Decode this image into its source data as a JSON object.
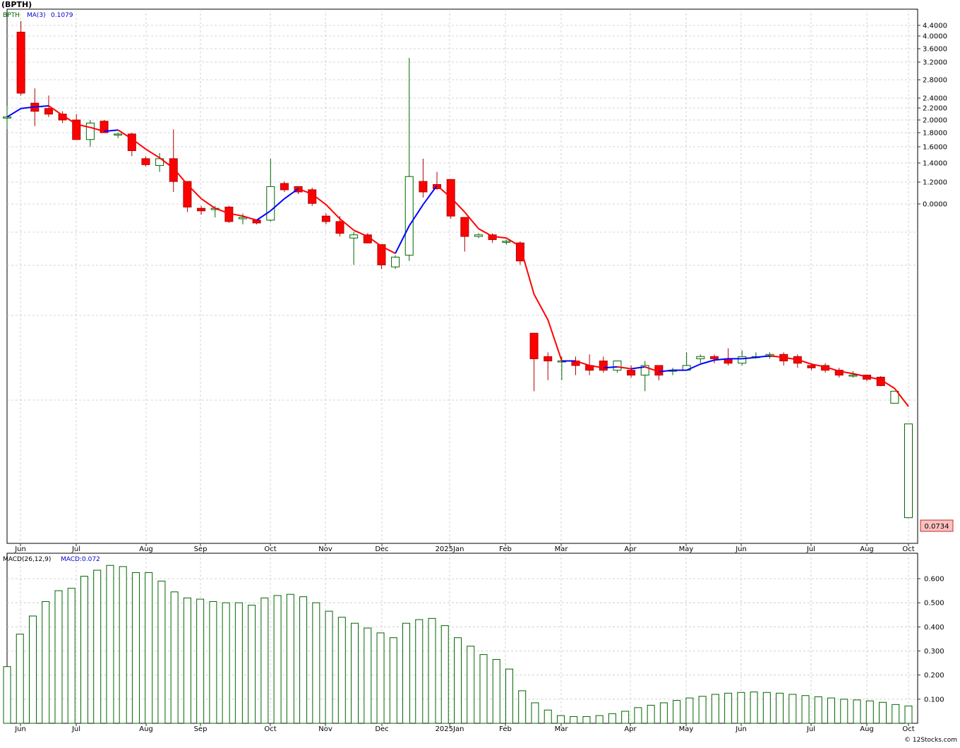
{
  "title": "(BPTH)",
  "watermark": "© 12Stocks.com",
  "price_panel": {
    "legend_symbol": "BPTH",
    "legend_ma_label": "MA(3)",
    "legend_ma_value": "0.1079",
    "last_price_label": "0.0734"
  },
  "macd_panel": {
    "legend_label": "MACD(26,12,9)",
    "legend_value": "MACD:0.072"
  },
  "colors": {
    "down_candle": "#ff0000",
    "up_candle": "#ffffff",
    "candle_outline_up": "#006600",
    "candle_outline_down": "#b00000",
    "ma_rising": "#0000ff",
    "ma_falling": "#ff0000",
    "macd_bar": "#006600",
    "grid": "#c8c8c8",
    "last_price_bg": "#ffc0c0"
  },
  "chart_data": [
    {
      "type": "candlestick",
      "title": "(BPTH)",
      "y_axis_tick_labels": [
        "4.4000",
        "4.0000",
        "3.6000",
        "3.2000",
        "2.8000",
        "2.4000",
        "2.2000",
        "2.0000",
        "1.8000",
        "1.6000",
        "1.4000",
        "1.2000",
        "0.0000"
      ],
      "x_axis_tick_labels": [
        "Jun",
        "Jul",
        "Aug",
        "Sep",
        "Oct",
        "Nov",
        "Dec",
        "2025Jan",
        "Feb",
        "Mar",
        "Apr",
        "May",
        "Jun",
        "Jul",
        "Aug",
        "Oct"
      ],
      "y_scale": "log",
      "grid": true,
      "candles": [
        {
          "o": 2.05,
          "h": 2.25,
          "l": 1.85,
          "c": 2.05
        },
        {
          "o": 4.15,
          "h": 4.55,
          "l": 2.45,
          "c": 2.5
        },
        {
          "o": 2.3,
          "h": 2.6,
          "l": 1.9,
          "c": 2.15
        },
        {
          "o": 2.2,
          "h": 2.45,
          "l": 2.05,
          "c": 2.1
        },
        {
          "o": 2.1,
          "h": 2.15,
          "l": 1.95,
          "c": 2.0
        },
        {
          "o": 2.0,
          "h": 2.1,
          "l": 1.7,
          "c": 1.7
        },
        {
          "o": 1.7,
          "h": 2.0,
          "l": 1.6,
          "c": 1.95
        },
        {
          "o": 1.98,
          "h": 2.0,
          "l": 1.8,
          "c": 1.8
        },
        {
          "o": 1.78,
          "h": 1.8,
          "l": 1.72,
          "c": 1.78
        },
        {
          "o": 1.78,
          "h": 1.8,
          "l": 1.48,
          "c": 1.55
        },
        {
          "o": 1.45,
          "h": 1.48,
          "l": 1.36,
          "c": 1.38
        },
        {
          "o": 1.37,
          "h": 1.52,
          "l": 1.3,
          "c": 1.45
        },
        {
          "o": 1.45,
          "h": 1.85,
          "l": 1.1,
          "c": 1.2
        },
        {
          "o": 1.2,
          "h": 1.2,
          "l": 0.93,
          "c": 0.97
        },
        {
          "o": 0.96,
          "h": 0.98,
          "l": 0.91,
          "c": 0.94
        },
        {
          "o": 0.95,
          "h": 0.98,
          "l": 0.89,
          "c": 0.96
        },
        {
          "o": 0.97,
          "h": 0.98,
          "l": 0.85,
          "c": 0.86
        },
        {
          "o": 0.88,
          "h": 0.92,
          "l": 0.84,
          "c": 0.89
        },
        {
          "o": 0.87,
          "h": 0.87,
          "l": 0.84,
          "c": 0.85
        },
        {
          "o": 0.87,
          "h": 1.45,
          "l": 0.86,
          "c": 1.15
        },
        {
          "o": 1.18,
          "h": 1.2,
          "l": 1.1,
          "c": 1.12
        },
        {
          "o": 1.15,
          "h": 1.15,
          "l": 1.08,
          "c": 1.1
        },
        {
          "o": 1.12,
          "h": 1.14,
          "l": 0.98,
          "c": 1.0
        },
        {
          "o": 0.9,
          "h": 0.92,
          "l": 0.84,
          "c": 0.86
        },
        {
          "o": 0.86,
          "h": 0.9,
          "l": 0.76,
          "c": 0.78
        },
        {
          "o": 0.75,
          "h": 0.79,
          "l": 0.6,
          "c": 0.77
        },
        {
          "o": 0.77,
          "h": 0.78,
          "l": 0.72,
          "c": 0.72
        },
        {
          "o": 0.71,
          "h": 0.71,
          "l": 0.58,
          "c": 0.6
        },
        {
          "o": 0.59,
          "h": 0.65,
          "l": 0.58,
          "c": 0.64
        },
        {
          "o": 0.65,
          "h": 3.35,
          "l": 0.62,
          "c": 1.25
        },
        {
          "o": 1.2,
          "h": 1.45,
          "l": 1.05,
          "c": 1.1
        },
        {
          "o": 1.17,
          "h": 1.3,
          "l": 1.12,
          "c": 1.13
        },
        {
          "o": 1.22,
          "h": 1.22,
          "l": 0.88,
          "c": 0.9
        },
        {
          "o": 0.89,
          "h": 0.89,
          "l": 0.67,
          "c": 0.76
        },
        {
          "o": 0.76,
          "h": 0.78,
          "l": 0.75,
          "c": 0.77
        },
        {
          "o": 0.77,
          "h": 0.78,
          "l": 0.72,
          "c": 0.74
        },
        {
          "o": 0.73,
          "h": 0.74,
          "l": 0.71,
          "c": 0.73
        },
        {
          "o": 0.72,
          "h": 0.73,
          "l": 0.6,
          "c": 0.62
        },
        {
          "o": 0.34,
          "h": 0.34,
          "l": 0.21,
          "c": 0.275
        },
        {
          "o": 0.28,
          "h": 0.29,
          "l": 0.23,
          "c": 0.27
        },
        {
          "o": 0.27,
          "h": 0.28,
          "l": 0.23,
          "c": 0.27
        },
        {
          "o": 0.27,
          "h": 0.28,
          "l": 0.24,
          "c": 0.26
        },
        {
          "o": 0.26,
          "h": 0.285,
          "l": 0.24,
          "c": 0.25
        },
        {
          "o": 0.27,
          "h": 0.28,
          "l": 0.245,
          "c": 0.25
        },
        {
          "o": 0.25,
          "h": 0.27,
          "l": 0.245,
          "c": 0.27
        },
        {
          "o": 0.25,
          "h": 0.26,
          "l": 0.235,
          "c": 0.24
        },
        {
          "o": 0.24,
          "h": 0.27,
          "l": 0.21,
          "c": 0.26
        },
        {
          "o": 0.26,
          "h": 0.26,
          "l": 0.23,
          "c": 0.24
        },
        {
          "o": 0.25,
          "h": 0.255,
          "l": 0.24,
          "c": 0.25
        },
        {
          "o": 0.25,
          "h": 0.29,
          "l": 0.25,
          "c": 0.26
        },
        {
          "o": 0.275,
          "h": 0.285,
          "l": 0.265,
          "c": 0.28
        },
        {
          "o": 0.28,
          "h": 0.285,
          "l": 0.265,
          "c": 0.275
        },
        {
          "o": 0.275,
          "h": 0.3,
          "l": 0.26,
          "c": 0.265
        },
        {
          "o": 0.265,
          "h": 0.295,
          "l": 0.26,
          "c": 0.28
        },
        {
          "o": 0.28,
          "h": 0.29,
          "l": 0.275,
          "c": 0.28
        },
        {
          "o": 0.28,
          "h": 0.29,
          "l": 0.275,
          "c": 0.285
        },
        {
          "o": 0.285,
          "h": 0.29,
          "l": 0.26,
          "c": 0.27
        },
        {
          "o": 0.28,
          "h": 0.285,
          "l": 0.255,
          "c": 0.265
        },
        {
          "o": 0.26,
          "h": 0.265,
          "l": 0.25,
          "c": 0.255
        },
        {
          "o": 0.26,
          "h": 0.265,
          "l": 0.245,
          "c": 0.25
        },
        {
          "o": 0.25,
          "h": 0.255,
          "l": 0.235,
          "c": 0.24
        },
        {
          "o": 0.24,
          "h": 0.248,
          "l": 0.235,
          "c": 0.24
        },
        {
          "o": 0.24,
          "h": 0.24,
          "l": 0.228,
          "c": 0.232
        },
        {
          "o": 0.236,
          "h": 0.238,
          "l": 0.219,
          "c": 0.22
        },
        {
          "o": 0.19,
          "h": 0.21,
          "l": 0.19,
          "c": 0.21
        },
        {
          "o": 0.0734,
          "h": 0.16,
          "l": 0.0734,
          "c": 0.16
        }
      ],
      "ma3": [
        2.05,
        2.2,
        2.23,
        2.25,
        2.08,
        1.93,
        1.88,
        1.82,
        1.84,
        1.71,
        1.57,
        1.46,
        1.34,
        1.17,
        1.04,
        0.96,
        0.92,
        0.9,
        0.87,
        0.94,
        1.04,
        1.13,
        1.08,
        0.99,
        0.88,
        0.8,
        0.76,
        0.7,
        0.66,
        0.83,
        0.99,
        1.16,
        1.05,
        0.93,
        0.81,
        0.76,
        0.75,
        0.7,
        0.47,
        0.38,
        0.27,
        0.27,
        0.26,
        0.255,
        0.257,
        0.253,
        0.257,
        0.247,
        0.25,
        0.25,
        0.263,
        0.272,
        0.275,
        0.275,
        0.278,
        0.282,
        0.278,
        0.273,
        0.263,
        0.257,
        0.248,
        0.243,
        0.237,
        0.231,
        0.215,
        0.185
      ]
    },
    {
      "type": "bar",
      "title": "MACD(26,12,9)",
      "y_axis_tick_labels": [
        "0.600",
        "0.500",
        "0.400",
        "0.300",
        "0.200",
        "0.100"
      ],
      "x_axis_tick_labels": [
        "Jun",
        "Jul",
        "Aug",
        "Sep",
        "Oct",
        "Nov",
        "Dec",
        "2025Jan",
        "Feb",
        "Mar",
        "Apr",
        "May",
        "Jun",
        "Jul",
        "Aug",
        "Oct"
      ],
      "ylim": [
        0.0,
        0.685
      ],
      "grid": true,
      "values": [
        0.235,
        0.37,
        0.445,
        0.505,
        0.55,
        0.56,
        0.61,
        0.635,
        0.655,
        0.65,
        0.625,
        0.625,
        0.59,
        0.545,
        0.52,
        0.515,
        0.505,
        0.5,
        0.5,
        0.49,
        0.52,
        0.53,
        0.535,
        0.525,
        0.5,
        0.465,
        0.44,
        0.415,
        0.395,
        0.375,
        0.355,
        0.415,
        0.43,
        0.435,
        0.405,
        0.355,
        0.32,
        0.285,
        0.265,
        0.225,
        0.135,
        0.085,
        0.055,
        0.032,
        0.028,
        0.028,
        0.032,
        0.04,
        0.05,
        0.065,
        0.075,
        0.085,
        0.095,
        0.105,
        0.112,
        0.12,
        0.125,
        0.128,
        0.13,
        0.128,
        0.125,
        0.12,
        0.115,
        0.11,
        0.105,
        0.1,
        0.097,
        0.093,
        0.087,
        0.078,
        0.072
      ]
    }
  ]
}
